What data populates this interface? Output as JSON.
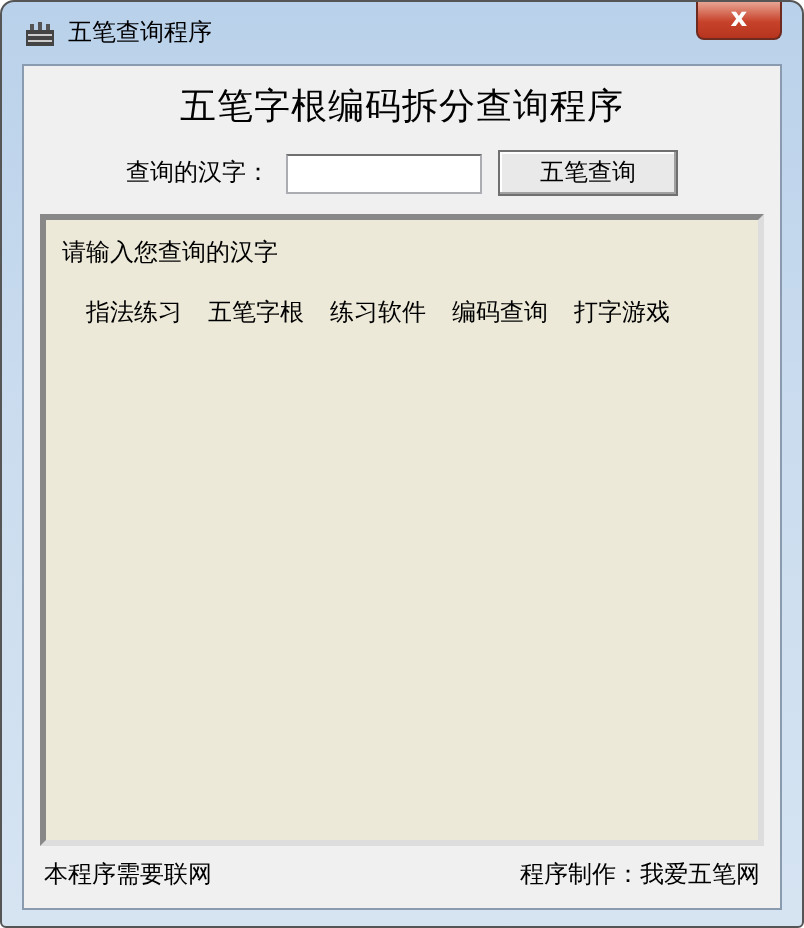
{
  "window": {
    "title": "五笔查询程序",
    "close": "x"
  },
  "heading": "五笔字根编码拆分查询程序",
  "search": {
    "label": "查询的汉字：",
    "button": "五笔查询"
  },
  "panel": {
    "prompt": "请输入您查询的汉字",
    "links": [
      "指法练习",
      "五笔字根",
      "练习软件",
      "编码查询",
      "打字游戏"
    ]
  },
  "status_bar": {
    "left": "本程序需要联网",
    "right": "程序制作：我爱五笔网"
  }
}
